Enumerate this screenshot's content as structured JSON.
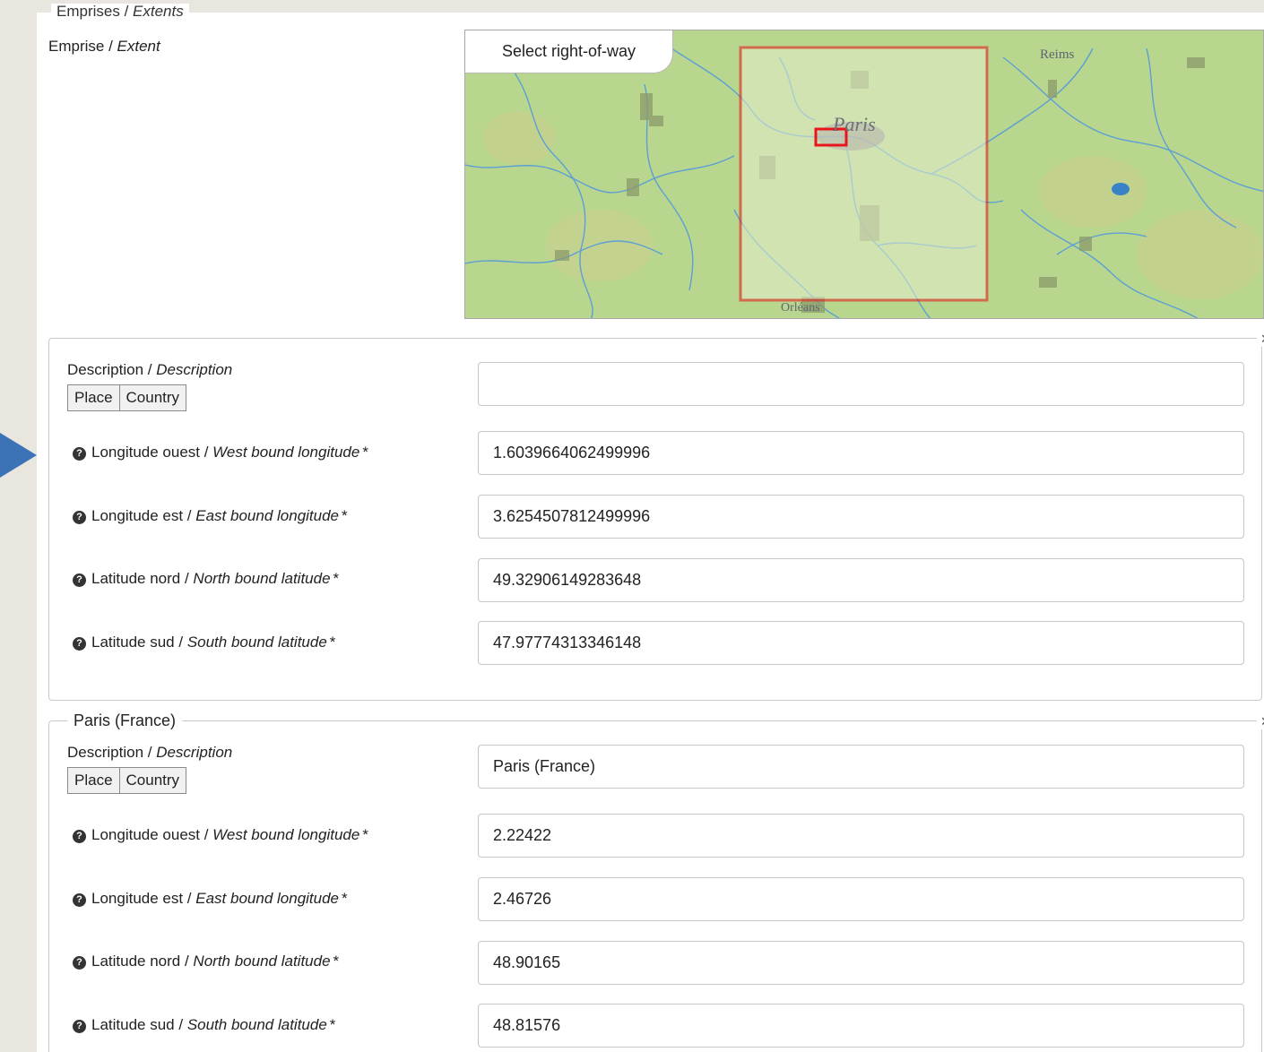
{
  "section": {
    "legend_main": "Emprises / ",
    "legend_italic": "Extents"
  },
  "extent": {
    "label_main": "Emprise / ",
    "label_italic": "Extent"
  },
  "map": {
    "tab_label": "Select right-of-way",
    "labels": {
      "paris": "Paris",
      "reims": "Reims",
      "orleans": "Orléans"
    },
    "colors": {
      "land": "#b9d68e",
      "rivers": "#5c9fd4",
      "urban": "#8c9a6a",
      "selection": "#e8151b",
      "selection_fill": "#e6efcc"
    }
  },
  "extents": [
    {
      "legend": "",
      "description": {
        "label_main": "Description / ",
        "label_italic": "Description",
        "value": "",
        "chips": [
          "Place",
          "Country"
        ]
      },
      "fields": [
        {
          "label_main": "Longitude ouest / ",
          "label_italic": "West bound longitude",
          "required": "*",
          "value": "1.6039664062499996"
        },
        {
          "label_main": "Longitude est / ",
          "label_italic": "East bound longitude",
          "required": "*",
          "value": "3.6254507812499996"
        },
        {
          "label_main": "Latitude nord / ",
          "label_italic": "North bound latitude",
          "required": "*",
          "value": "49.32906149283648"
        },
        {
          "label_main": "Latitude sud / ",
          "label_italic": "South bound latitude",
          "required": "*",
          "value": "47.97774313346148"
        }
      ],
      "close_icon": "×"
    },
    {
      "legend": "Paris (France)",
      "description": {
        "label_main": "Description / ",
        "label_italic": "Description",
        "value": "Paris (France)",
        "chips": [
          "Place",
          "Country"
        ]
      },
      "fields": [
        {
          "label_main": "Longitude ouest / ",
          "label_italic": "West bound longitude",
          "required": "*",
          "value": "2.22422"
        },
        {
          "label_main": "Longitude est / ",
          "label_italic": "East bound longitude",
          "required": "*",
          "value": "2.46726"
        },
        {
          "label_main": "Latitude nord / ",
          "label_italic": "North bound latitude",
          "required": "*",
          "value": "48.90165"
        },
        {
          "label_main": "Latitude sud / ",
          "label_italic": "South bound latitude",
          "required": "*",
          "value": "48.81576"
        }
      ],
      "close_icon": "×"
    }
  ],
  "help_icon": "?",
  "arrow_color": "#3c73b6"
}
